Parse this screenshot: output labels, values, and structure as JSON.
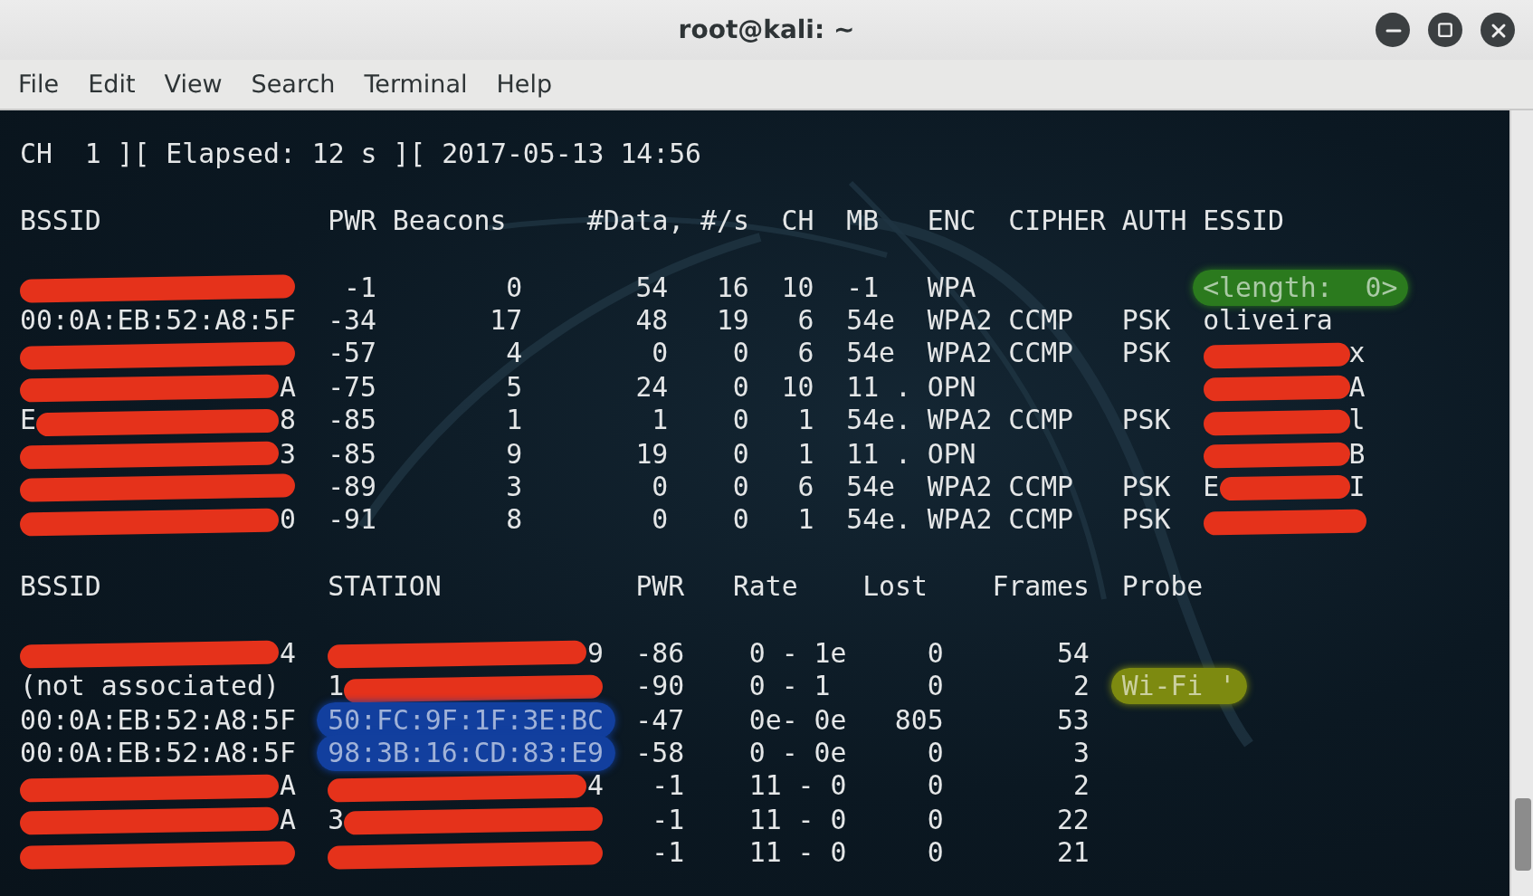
{
  "window": {
    "title": "root@kali: ~"
  },
  "menu": [
    "File",
    "Edit",
    "View",
    "Search",
    "Terminal",
    "Help"
  ],
  "status_line": "CH  1 ][ Elapsed: 12 s ][ 2017-05-13 14:56",
  "access_points": {
    "columns": [
      "BSSID",
      "PWR",
      "Beacons",
      "#Data,",
      "#/s",
      "CH",
      "MB",
      "ENC",
      "CIPHER",
      "AUTH",
      "ESSID"
    ],
    "rows": [
      {
        "bssid": {
          "redacted": true
        },
        "pwr": "-1",
        "beacons": "0",
        "data": "54",
        "rate": "16",
        "ch": "10",
        "mb": "-1",
        "enc": "WPA",
        "essid": {
          "text": "<length:  0>",
          "color": "#2b7a1e"
        }
      },
      {
        "bssid": "00:0A:EB:52:A8:5F",
        "pwr": "-34",
        "beacons": "17",
        "data": "48",
        "rate": "19",
        "ch": "6",
        "mb": "54e",
        "enc": "WPA2",
        "cipher": "CCMP",
        "auth": "PSK",
        "essid": "oliveira"
      },
      {
        "bssid": {
          "redacted": true
        },
        "pwr": "-57",
        "beacons": "4",
        "data": "0",
        "rate": "0",
        "ch": "6",
        "mb": "54e",
        "enc": "WPA2",
        "cipher": "CCMP",
        "auth": "PSK",
        "essid": {
          "redacted": true,
          "tail": "x"
        }
      },
      {
        "bssid": {
          "redacted": true,
          "tail": "A"
        },
        "pwr": "-75",
        "beacons": "5",
        "data": "24",
        "rate": "0",
        "ch": "10",
        "mb": "11 .",
        "enc": "OPN",
        "essid": {
          "redacted": true,
          "tail": "A"
        }
      },
      {
        "bssid": {
          "redacted": true,
          "head": "E",
          "tail": "8"
        },
        "pwr": "-85",
        "beacons": "1",
        "data": "1",
        "rate": "0",
        "ch": "1",
        "mb": "54e.",
        "enc": "WPA2",
        "cipher": "CCMP",
        "auth": "PSK",
        "essid": {
          "redacted": true,
          "tail": "l"
        }
      },
      {
        "bssid": {
          "redacted": true,
          "tail": "3"
        },
        "pwr": "-85",
        "beacons": "9",
        "data": "19",
        "rate": "0",
        "ch": "1",
        "mb": "11 .",
        "enc": "OPN",
        "essid": {
          "redacted": true,
          "tail": "B"
        }
      },
      {
        "bssid": {
          "redacted": true
        },
        "pwr": "-89",
        "beacons": "3",
        "data": "0",
        "rate": "0",
        "ch": "6",
        "mb": "54e",
        "enc": "WPA2",
        "cipher": "CCMP",
        "auth": "PSK",
        "essid": {
          "redacted": true,
          "head": "E",
          "tail": "I"
        }
      },
      {
        "bssid": {
          "redacted": true,
          "tail": "0"
        },
        "pwr": "-91",
        "beacons": "8",
        "data": "0",
        "rate": "0",
        "ch": "1",
        "mb": "54e.",
        "enc": "WPA2",
        "cipher": "CCMP",
        "auth": "PSK",
        "essid": {
          "redacted": true
        }
      }
    ]
  },
  "stations": {
    "columns": [
      "BSSID",
      "STATION",
      "PWR",
      "Rate",
      "Lost",
      "Frames",
      "Probe"
    ],
    "rows": [
      {
        "bssid": {
          "redacted": true,
          "tail": "4"
        },
        "station": {
          "redacted": true,
          "tail": "9"
        },
        "pwr": "-86",
        "rate": "0 - 1e",
        "lost": "0",
        "frames": "54"
      },
      {
        "bssid": "(not associated)",
        "station": {
          "redacted": true,
          "head": "1"
        },
        "pwr": "-90",
        "rate": "0 - 1",
        "lost": "0",
        "frames": "2",
        "probe": {
          "text": "Wi-Fi '",
          "color": "#7d8a10"
        }
      },
      {
        "bssid": "00:0A:EB:52:A8:5F",
        "station": {
          "text": "50:FC:9F:1F:3E:BC",
          "color": "#123f9e"
        },
        "pwr": "-47",
        "rate": "0e- 0e",
        "lost": "805",
        "frames": "53"
      },
      {
        "bssid": "00:0A:EB:52:A8:5F",
        "station": {
          "text": "98:3B:16:CD:83:E9",
          "color": "#123f9e"
        },
        "pwr": "-58",
        "rate": "0 - 0e",
        "lost": "0",
        "frames": "3"
      },
      {
        "bssid": {
          "redacted": true,
          "tail": "A"
        },
        "station": {
          "redacted": true,
          "tail": "4"
        },
        "pwr": "-1",
        "rate": "11 - 0",
        "lost": "0",
        "frames": "2"
      },
      {
        "bssid": {
          "redacted": true,
          "tail": "A"
        },
        "station": {
          "redacted": true,
          "head": "3"
        },
        "pwr": "-1",
        "rate": "11 - 0",
        "lost": "0",
        "frames": "22"
      },
      {
        "bssid": {
          "redacted": true
        },
        "station": {
          "redacted": true
        },
        "pwr": "-1",
        "rate": "11 - 0",
        "lost": "0",
        "frames": "21"
      }
    ]
  }
}
